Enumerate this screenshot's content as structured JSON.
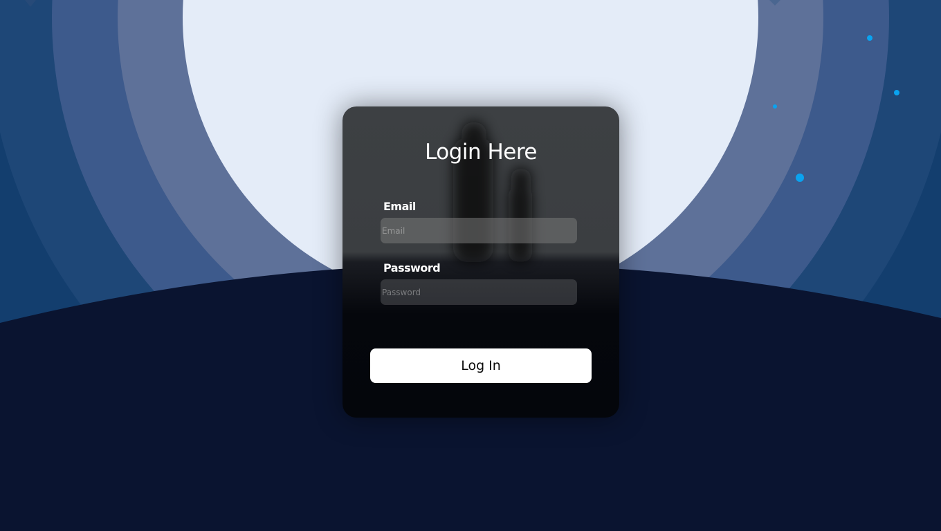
{
  "login": {
    "title": "Login Here",
    "email_label": "Email",
    "email_placeholder": "Email",
    "email_value": "",
    "password_label": "Password",
    "password_placeholder": "Password",
    "password_value": "",
    "submit_label": "Log In"
  },
  "colors": {
    "background_outer": "#133e6e",
    "ring_1": "#1e4777",
    "ring_2": "#3d5a8c",
    "ring_3": "#5e7199",
    "moon": "#e4ecf8",
    "hill": "#0a1430",
    "star": "#0aa3f0",
    "card": "#3d4043",
    "button": "#ffffff"
  }
}
